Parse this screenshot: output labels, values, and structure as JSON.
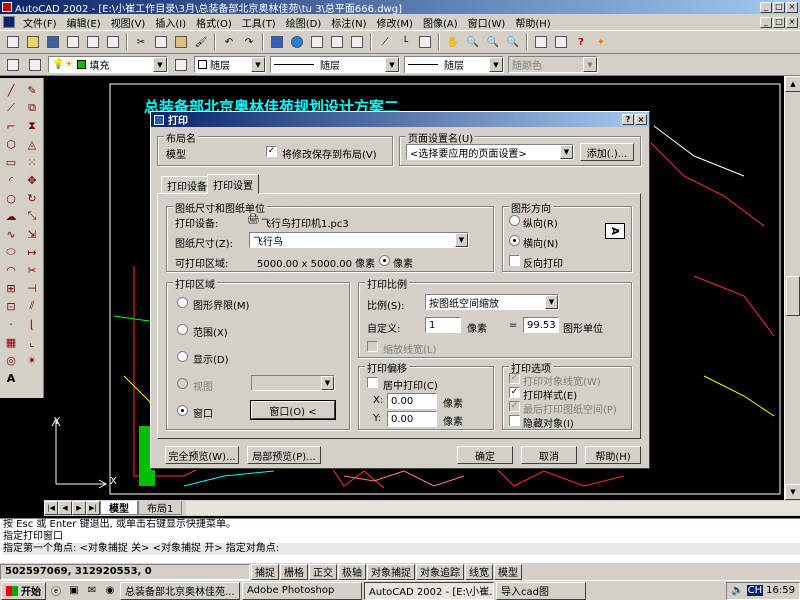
{
  "window": {
    "title": "AutoCAD 2002 - [E:\\小崔工作目录\\3月\\总装备部北京奥林佳苑\\tu 3\\总平面666.dwg]",
    "min": "_",
    "max": "□",
    "close": "×"
  },
  "menu": [
    "文件(F)",
    "编辑(E)",
    "视图(V)",
    "插入(I)",
    "格式(O)",
    "工具(T)",
    "绘图(D)",
    "标注(N)",
    "修改(M)",
    "图像(A)",
    "窗口(W)",
    "帮助(H)"
  ],
  "layer_bar": {
    "layer_name": "填充",
    "color": "随层",
    "linetype": "随层",
    "lineweight": "随层",
    "plotstyle": "随颜色"
  },
  "drawing": {
    "title": "总装备部北京奥林佳苑规划设计方案二",
    "ucs_x": "X",
    "ucs_y": "Y"
  },
  "layout_tabs": {
    "model": "模型",
    "layout1": "布局1"
  },
  "command": {
    "lines": [
      "按 Esc 或 Enter 键退出, 或单击右键显示快捷菜单。",
      "指定打印窗口",
      "指定第一个角点: <对象捕捉 关> <对象捕捉 开> 指定对角点:"
    ]
  },
  "status": {
    "coords": "502597069, 312920553, 0",
    "buttons": [
      "捕捉",
      "栅格",
      "正交",
      "极轴",
      "对象捕捉",
      "对象追踪",
      "线宽",
      "模型"
    ]
  },
  "taskbar": {
    "start": "开始",
    "tasks": [
      "总装备部北京奥林佳苑...",
      "Adobe Photoshop",
      "AutoCAD 2002 - [E:\\小崔...",
      "导入cad图"
    ],
    "lang": "CH",
    "time": "16:59"
  },
  "dialog": {
    "title": "打印",
    "help_btn": "?",
    "close_btn": "×",
    "layout_group": "布局名",
    "layout_name": "模型",
    "save_to_layout": "将修改保存到布局(V)",
    "page_setup_group": "页面设置名(U)",
    "page_setup_value": "<选择要应用的页面设置>",
    "add_btn": "添加(.)...",
    "tabs": [
      "打印设备",
      "打印设置"
    ],
    "paper_group": "图纸尺寸和图纸单位",
    "device_label": "打印设备:",
    "device_value": "飞行鸟打印机1.pc3",
    "paper_size_label": "图纸尺寸(Z):",
    "paper_size_value": "飞行鸟",
    "printable_label": "可打印区域:",
    "printable_value": "5000.00 x 5000.00 像素",
    "unit_pixel": "像素",
    "orientation_group": "图形方向",
    "portrait": "纵向(R)",
    "landscape": "横向(N)",
    "reverse": "反向打印",
    "orient_icon": "A",
    "area_group": "打印区域",
    "limits": "图形界限(M)",
    "extents": "范围(X)",
    "display": "显示(D)",
    "view": "视图",
    "window": "窗口",
    "window_btn": "窗口(O) <",
    "scale_group": "打印比例",
    "scale_label": "比例(S):",
    "scale_value": "按图纸空间缩放",
    "custom_label": "自定义:",
    "custom_value1": "1",
    "custom_unit1": "像素",
    "equals": "=",
    "custom_value2": "99.53",
    "custom_unit2": "图形单位",
    "scale_lineweight": "缩放线宽(L)",
    "offset_group": "打印偏移",
    "center_plot": "居中打印(C)",
    "x_label": "X:",
    "x_value": "0.00",
    "y_label": "Y:",
    "y_value": "0.00",
    "offset_unit": "像素",
    "options_group": "打印选项",
    "opt_lineweights": "打印对象线宽(W)",
    "opt_plotstyles": "打印样式(E)",
    "opt_paperspace_last": "最后打印图纸空间(P)",
    "opt_hide": "隐藏对象(I)",
    "full_preview": "完全预览(W)...",
    "partial_preview": "局部预览(P)...",
    "ok": "确定",
    "cancel": "取消",
    "help": "帮助(H)"
  },
  "colors": {
    "title_start": "#0a246a",
    "title_end": "#a6caf0",
    "drawing_bg": "#000000",
    "drawing_title": "#00ffff"
  }
}
